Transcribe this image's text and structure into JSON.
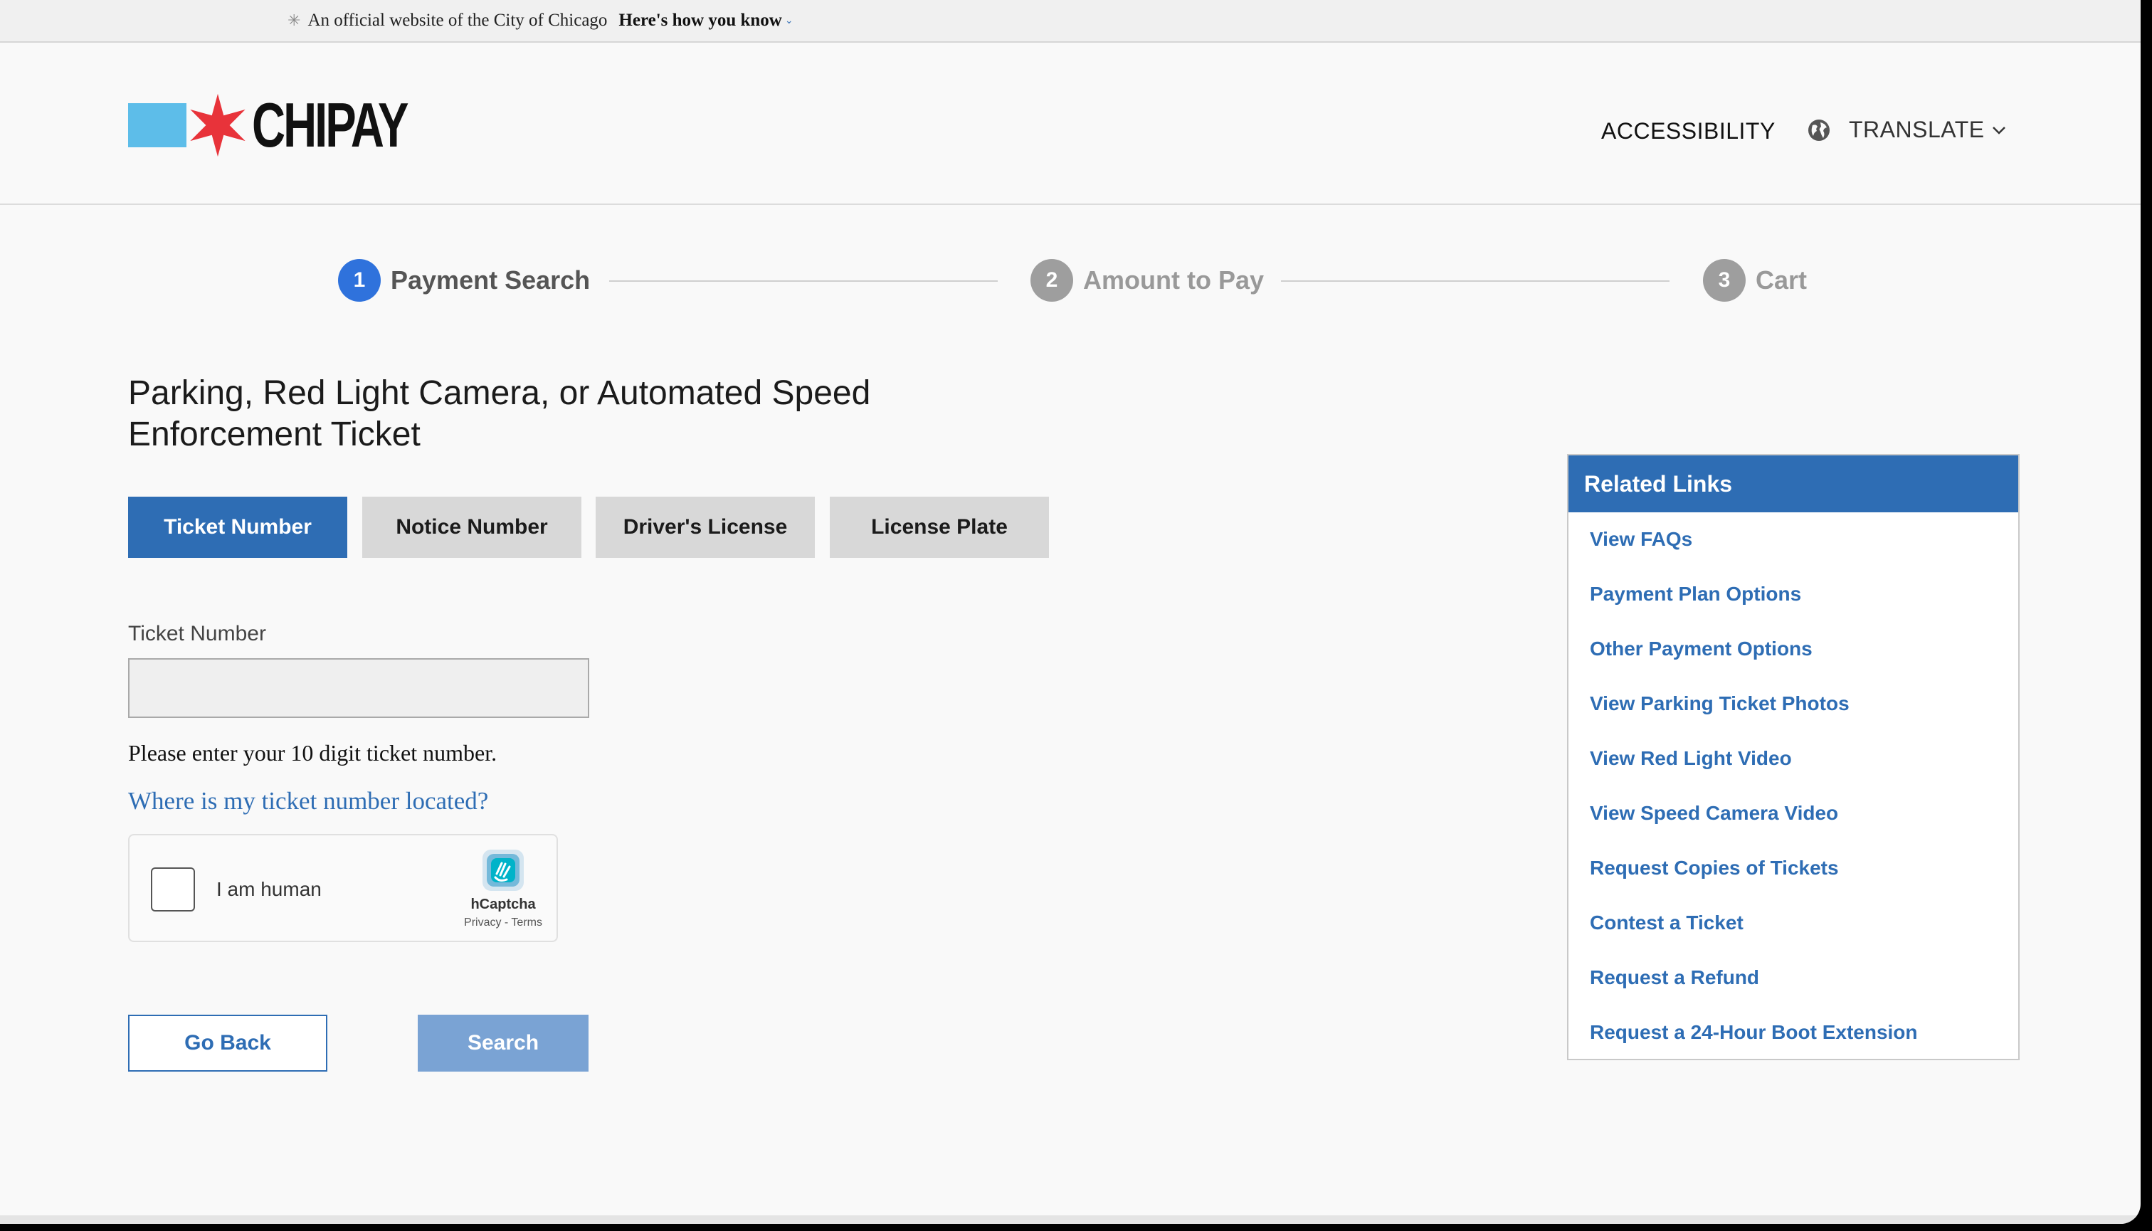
{
  "banner": {
    "text": "An official website of the City of Chicago",
    "how_link": "Here's how you know"
  },
  "header": {
    "logo_text": "CHIPAY",
    "accessibility": "ACCESSIBILITY",
    "translate": "TRANSLATE"
  },
  "colors": {
    "primary_blue": "#2e6db4",
    "step_active": "#2f72dc",
    "flag_blue": "#5dbde9",
    "star_red": "#e8333a"
  },
  "stepper": {
    "steps": [
      {
        "number": "1",
        "label": "Payment Search",
        "state": "active"
      },
      {
        "number": "2",
        "label": "Amount to Pay",
        "state": "inactive"
      },
      {
        "number": "3",
        "label": "Cart",
        "state": "inactive"
      }
    ]
  },
  "main": {
    "title": "Parking, Red Light Camera, or Automated Speed Enforcement Ticket",
    "tabs": [
      {
        "label": "Ticket Number",
        "selected": true
      },
      {
        "label": "Notice Number",
        "selected": false
      },
      {
        "label": "Driver's License",
        "selected": false
      },
      {
        "label": "License Plate",
        "selected": false
      }
    ],
    "field_label": "Ticket Number",
    "field_value": "",
    "help_text": "Please enter your 10 digit ticket number.",
    "help_link": "Where is my ticket number located?",
    "captcha": {
      "label": "I am human",
      "brand": "hCaptcha",
      "terms": "Privacy - Terms"
    },
    "go_back": "Go Back",
    "search": "Search"
  },
  "related_links": {
    "title": "Related Links",
    "items": [
      "View FAQs",
      "Payment Plan Options",
      "Other Payment Options",
      "View Parking Ticket Photos",
      "View Red Light Video",
      "View Speed Camera Video",
      "Request Copies of Tickets",
      "Contest a Ticket",
      "Request a Refund",
      "Request a 24-Hour Boot Extension"
    ]
  }
}
